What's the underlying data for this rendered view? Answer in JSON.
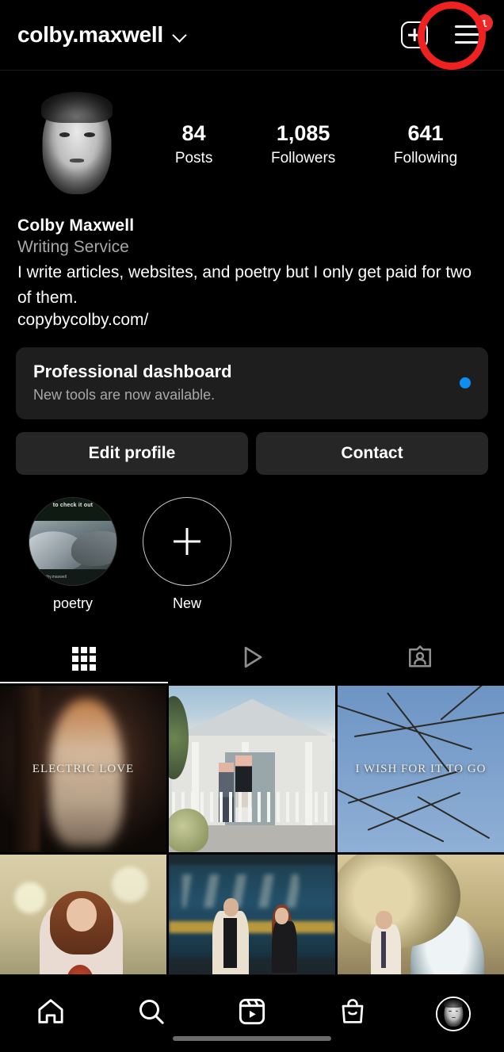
{
  "header": {
    "username": "colby.maxwell",
    "chevron_icon": "chevron-down-icon",
    "new_post_icon": "plus-square-icon",
    "menu_icon": "hamburger-menu-icon",
    "menu_badge": "1",
    "annotation_color": "#f02121"
  },
  "profile": {
    "avatar_alt": "profile-photo",
    "stats": [
      {
        "num": "84",
        "label": "Posts"
      },
      {
        "num": "1,085",
        "label": "Followers"
      },
      {
        "num": "641",
        "label": "Following"
      }
    ],
    "name": "Colby  Maxwell",
    "category": "Writing Service",
    "bio": "I write articles, websites, and poetry but I only get paid for two of them.",
    "link": "copybycolby.com/"
  },
  "dashboard": {
    "title": "Professional dashboard",
    "subtitle": "New tools are now available.",
    "dot_color": "#0e8ef0"
  },
  "actions": {
    "edit_profile": "Edit profile",
    "contact": "Contact"
  },
  "highlights": [
    {
      "label": "poetry",
      "type": "story",
      "caption": "to check it out",
      "handle": "@colby.maxwell"
    },
    {
      "label": "New",
      "type": "new"
    }
  ],
  "tabs": [
    {
      "name": "grid",
      "icon": "grid-icon",
      "active": true
    },
    {
      "name": "reels",
      "icon": "play-triangle-icon",
      "active": false
    },
    {
      "name": "tagged",
      "icon": "tagged-person-icon",
      "active": false
    }
  ],
  "posts": [
    {
      "caption": "ELECTRIC LOVE",
      "art": "electric"
    },
    {
      "caption": "",
      "art": "house"
    },
    {
      "caption": "I WISH FOR IT TO GO",
      "art": "sky"
    },
    {
      "caption": "",
      "art": "woman"
    },
    {
      "caption": "",
      "art": "train"
    },
    {
      "caption": "",
      "art": "tunnel"
    }
  ],
  "bottom_nav": [
    {
      "name": "home",
      "icon": "home-icon"
    },
    {
      "name": "search",
      "icon": "search-icon"
    },
    {
      "name": "reels",
      "icon": "reels-icon"
    },
    {
      "name": "shop",
      "icon": "shopping-bag-icon"
    },
    {
      "name": "profile",
      "icon": "avatar-icon"
    }
  ]
}
